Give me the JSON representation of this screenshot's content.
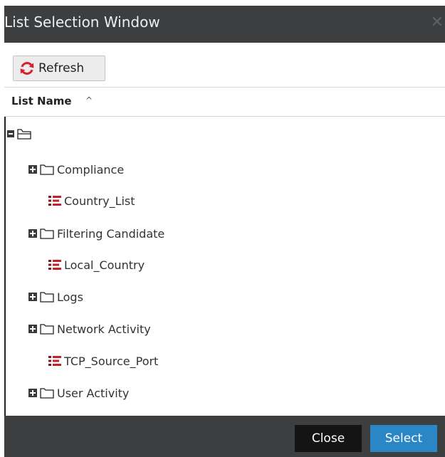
{
  "window": {
    "title": "List Selection Window",
    "close_glyph": "✕"
  },
  "toolbar": {
    "refresh_label": "Refresh",
    "refresh_icon": "refresh-icon",
    "refresh_icon_color": "#d9202a"
  },
  "list_header": {
    "column_label": "List Name",
    "sort_arrow": "^"
  },
  "tree": {
    "root": {
      "expanded": true,
      "icon": "open-folder-icon"
    },
    "items": [
      {
        "label": "Compliance",
        "kind": "folder",
        "icon": "folder-icon"
      },
      {
        "label": "Country_List",
        "kind": "list",
        "icon": "list-icon"
      },
      {
        "label": "Filtering Candidate",
        "kind": "folder",
        "icon": "folder-icon"
      },
      {
        "label": "Local_Country",
        "kind": "list",
        "icon": "list-icon"
      },
      {
        "label": "Logs",
        "kind": "folder",
        "icon": "folder-icon"
      },
      {
        "label": "Network Activity",
        "kind": "folder",
        "icon": "folder-icon"
      },
      {
        "label": "TCP_Source_Port",
        "kind": "list",
        "icon": "list-icon"
      },
      {
        "label": "User Activity",
        "kind": "folder",
        "icon": "folder-icon"
      }
    ]
  },
  "footer": {
    "close_label": "Close",
    "select_label": "Select",
    "select_color": "#2b86c5"
  }
}
